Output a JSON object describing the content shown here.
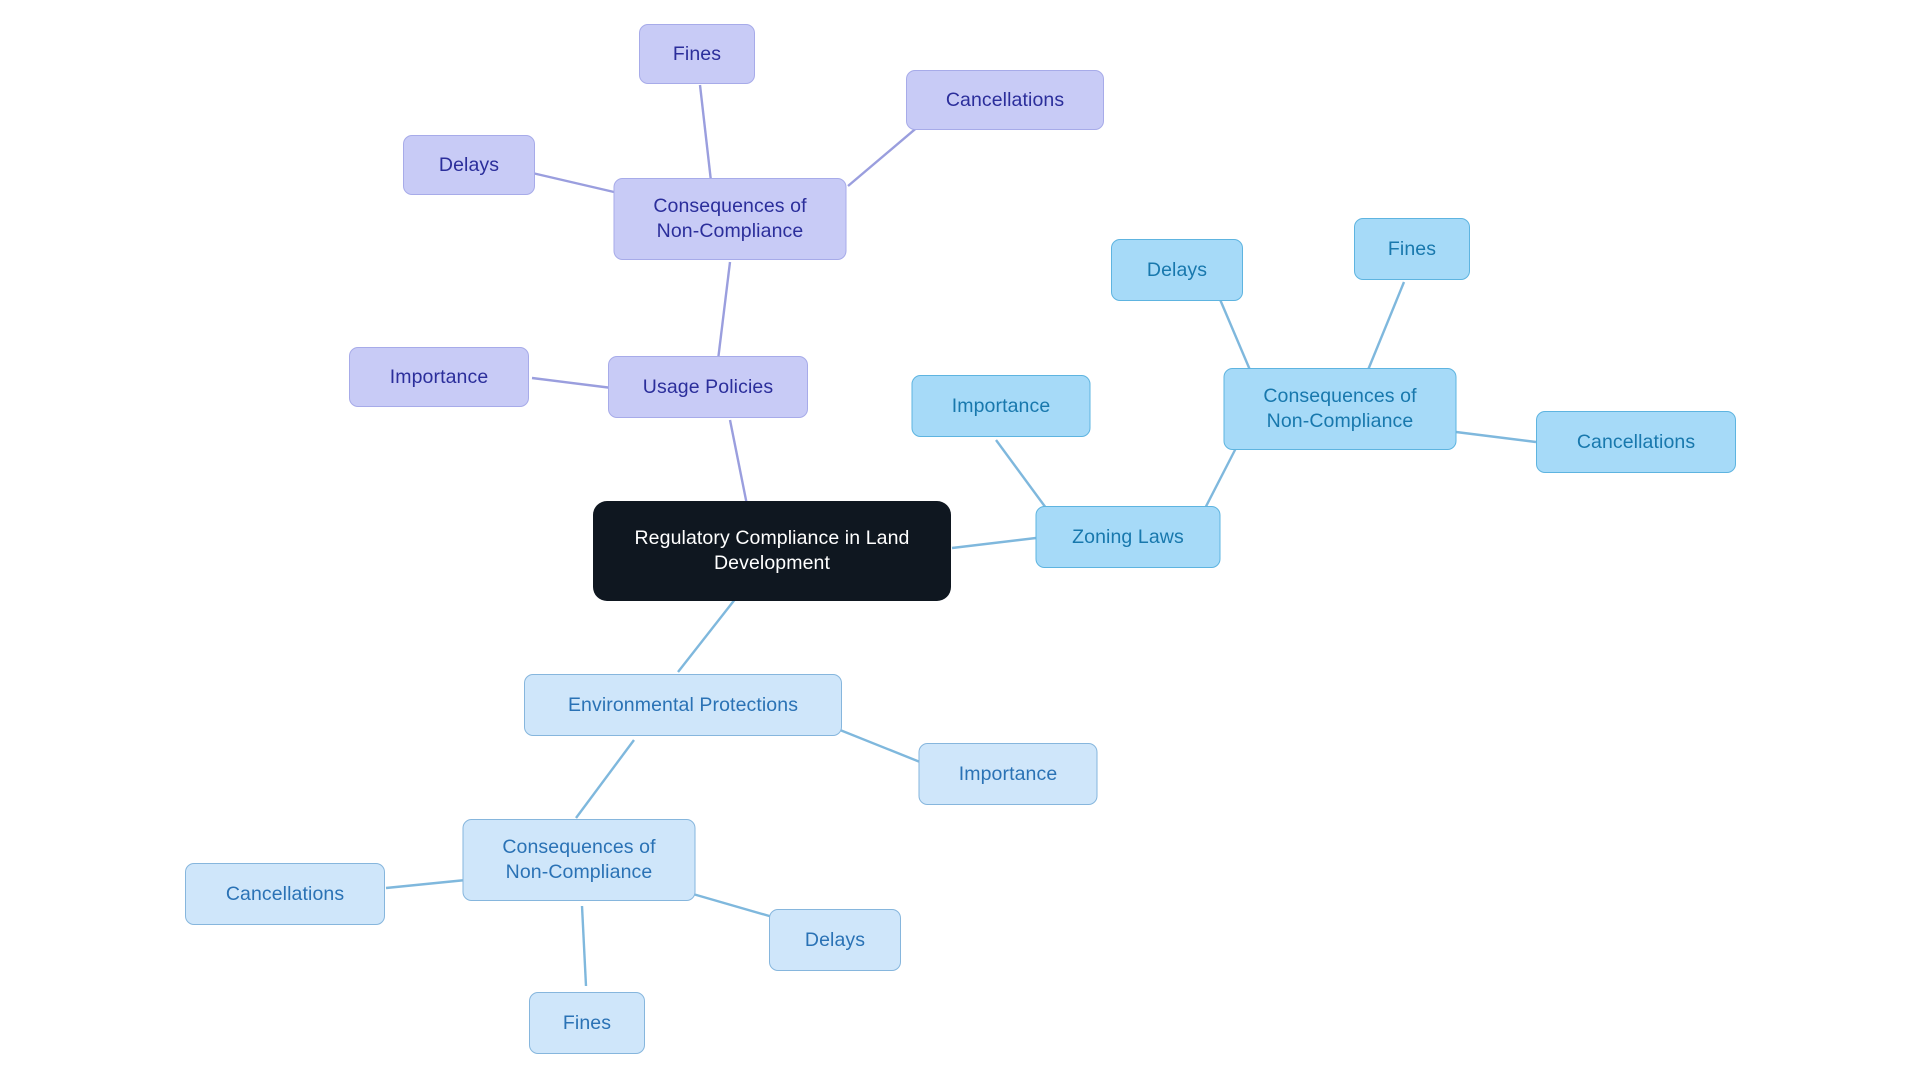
{
  "diagram": {
    "type": "mindmap",
    "title": "Regulatory Compliance in Land Development",
    "background": "#ffffff",
    "palette": {
      "root_fill": "#0f1720",
      "root_text": "#ffffff",
      "purple_fill": "#c8cbf6",
      "purple_border": "#a7abe9",
      "purple_text": "#2b2e9b",
      "blue_mid_fill": "#a6daf8",
      "blue_mid_border": "#5eb4e0",
      "blue_mid_text": "#1878ad",
      "blue_light_fill": "#cfe6fa",
      "blue_light_border": "#86b6dd",
      "blue_light_text": "#2a72b5",
      "edge_purple": "#9a9ede",
      "edge_blue": "#7fb8dd"
    }
  },
  "nodes": {
    "root": {
      "label": "Regulatory Compliance in Land\nDevelopment"
    },
    "usage_policies": {
      "label": "Usage Policies"
    },
    "usage_importance": {
      "label": "Importance"
    },
    "usage_consequences": {
      "label": "Consequences of\nNon-Compliance"
    },
    "usage_fines": {
      "label": "Fines"
    },
    "usage_delays": {
      "label": "Delays"
    },
    "usage_cancellations": {
      "label": "Cancellations"
    },
    "zoning_laws": {
      "label": "Zoning Laws"
    },
    "zoning_importance": {
      "label": "Importance"
    },
    "zoning_consequences": {
      "label": "Consequences of\nNon-Compliance"
    },
    "zoning_delays": {
      "label": "Delays"
    },
    "zoning_fines": {
      "label": "Fines"
    },
    "zoning_cancellations": {
      "label": "Cancellations"
    },
    "environmental": {
      "label": "Environmental Protections"
    },
    "env_importance": {
      "label": "Importance"
    },
    "env_consequences": {
      "label": "Consequences of\nNon-Compliance"
    },
    "env_cancellations": {
      "label": "Cancellations"
    },
    "env_delays": {
      "label": "Delays"
    },
    "env_fines": {
      "label": "Fines"
    }
  },
  "edges": [
    {
      "from": "root",
      "to": "usage_policies",
      "color": "#9a9ede"
    },
    {
      "from": "usage_policies",
      "to": "usage_importance",
      "color": "#9a9ede"
    },
    {
      "from": "usage_policies",
      "to": "usage_consequences",
      "color": "#9a9ede"
    },
    {
      "from": "usage_consequences",
      "to": "usage_fines",
      "color": "#9a9ede"
    },
    {
      "from": "usage_consequences",
      "to": "usage_delays",
      "color": "#9a9ede"
    },
    {
      "from": "usage_consequences",
      "to": "usage_cancellations",
      "color": "#9a9ede"
    },
    {
      "from": "root",
      "to": "zoning_laws",
      "color": "#7fb8dd"
    },
    {
      "from": "zoning_laws",
      "to": "zoning_importance",
      "color": "#7fb8dd"
    },
    {
      "from": "zoning_laws",
      "to": "zoning_consequences",
      "color": "#7fb8dd"
    },
    {
      "from": "zoning_consequences",
      "to": "zoning_delays",
      "color": "#7fb8dd"
    },
    {
      "from": "zoning_consequences",
      "to": "zoning_fines",
      "color": "#7fb8dd"
    },
    {
      "from": "zoning_consequences",
      "to": "zoning_cancellations",
      "color": "#7fb8dd"
    },
    {
      "from": "root",
      "to": "environmental",
      "color": "#7fb8dd"
    },
    {
      "from": "environmental",
      "to": "env_importance",
      "color": "#7fb8dd"
    },
    {
      "from": "environmental",
      "to": "env_consequences",
      "color": "#7fb8dd"
    },
    {
      "from": "env_consequences",
      "to": "env_cancellations",
      "color": "#7fb8dd"
    },
    {
      "from": "env_consequences",
      "to": "env_delays",
      "color": "#7fb8dd"
    },
    {
      "from": "env_consequences",
      "to": "env_fines",
      "color": "#7fb8dd"
    }
  ]
}
